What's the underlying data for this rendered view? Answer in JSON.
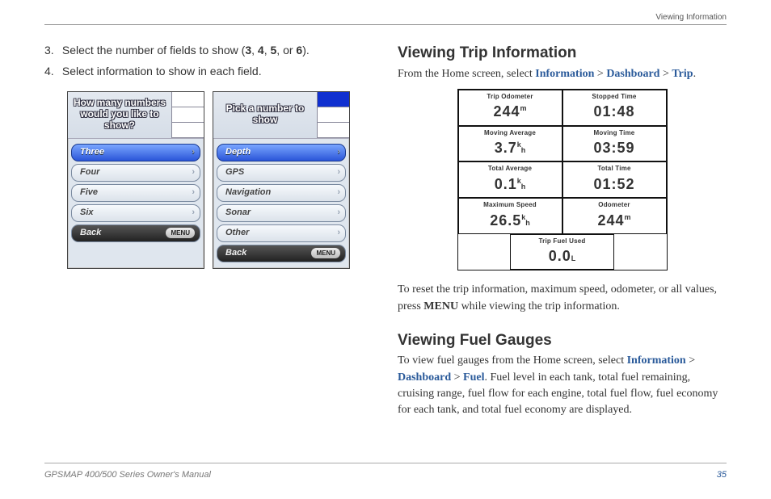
{
  "header": {
    "section": "Viewing Information"
  },
  "left": {
    "step3_pre": "Select the number of fields to show (",
    "step3_nums": [
      "3",
      "4",
      "5",
      "6"
    ],
    "step3_post": ").",
    "step4": "Select information to show in each field.",
    "dev1": {
      "prompt": "How many numbers would you like to show?",
      "items": [
        "Three",
        "Four",
        "Five",
        "Six"
      ],
      "back": "Back",
      "menu": "MENU",
      "selected": 0
    },
    "dev2": {
      "prompt": "Pick a number to show",
      "items": [
        "Depth",
        "GPS",
        "Navigation",
        "Sonar",
        "Other"
      ],
      "back": "Back",
      "menu": "MENU",
      "selected": 0
    }
  },
  "right": {
    "h_trip": "Viewing Trip Information",
    "trip_path_pre": "From the Home screen, select ",
    "trip_path": [
      "Information",
      "Dashboard",
      "Trip"
    ],
    "trip_table": [
      {
        "label": "Trip Odometer",
        "value": "244",
        "unit_sup": "m",
        "unit_sub": ""
      },
      {
        "label": "Stopped Time",
        "value": "01:48",
        "unit_sup": "",
        "unit_sub": ""
      },
      {
        "label": "Moving Average",
        "value": "3.7",
        "unit_sup": "k",
        "unit_sub": "h"
      },
      {
        "label": "Moving Time",
        "value": "03:59",
        "unit_sup": "",
        "unit_sub": ""
      },
      {
        "label": "Total Average",
        "value": "0.1",
        "unit_sup": "k",
        "unit_sub": "h"
      },
      {
        "label": "Total Time",
        "value": "01:52",
        "unit_sup": "",
        "unit_sub": ""
      },
      {
        "label": "Maximum Speed",
        "value": "26.5",
        "unit_sup": "k",
        "unit_sub": "h"
      },
      {
        "label": "Odometer",
        "value": "244",
        "unit_sup": "m",
        "unit_sub": ""
      },
      {
        "label": "Trip Fuel Used",
        "value": "0.0",
        "unit_sup": "",
        "unit_sub": "L"
      }
    ],
    "reset_pre": "To reset the trip information, maximum speed, odometer, or all values, press ",
    "reset_bold": "MENU",
    "reset_post": " while viewing the trip information.",
    "h_fuel": "Viewing Fuel Gauges",
    "fuel_pre": "To view fuel gauges from the Home screen, select ",
    "fuel_path": [
      "Information",
      "Dashboard",
      "Fuel"
    ],
    "fuel_post": ". Fuel level in each tank, total fuel remaining, cruising range, fuel flow for each engine, total fuel flow, fuel economy for each tank, and total fuel economy are displayed."
  },
  "footer": {
    "left": "GPSMAP 400/500 Series Owner's Manual",
    "page": "35"
  }
}
